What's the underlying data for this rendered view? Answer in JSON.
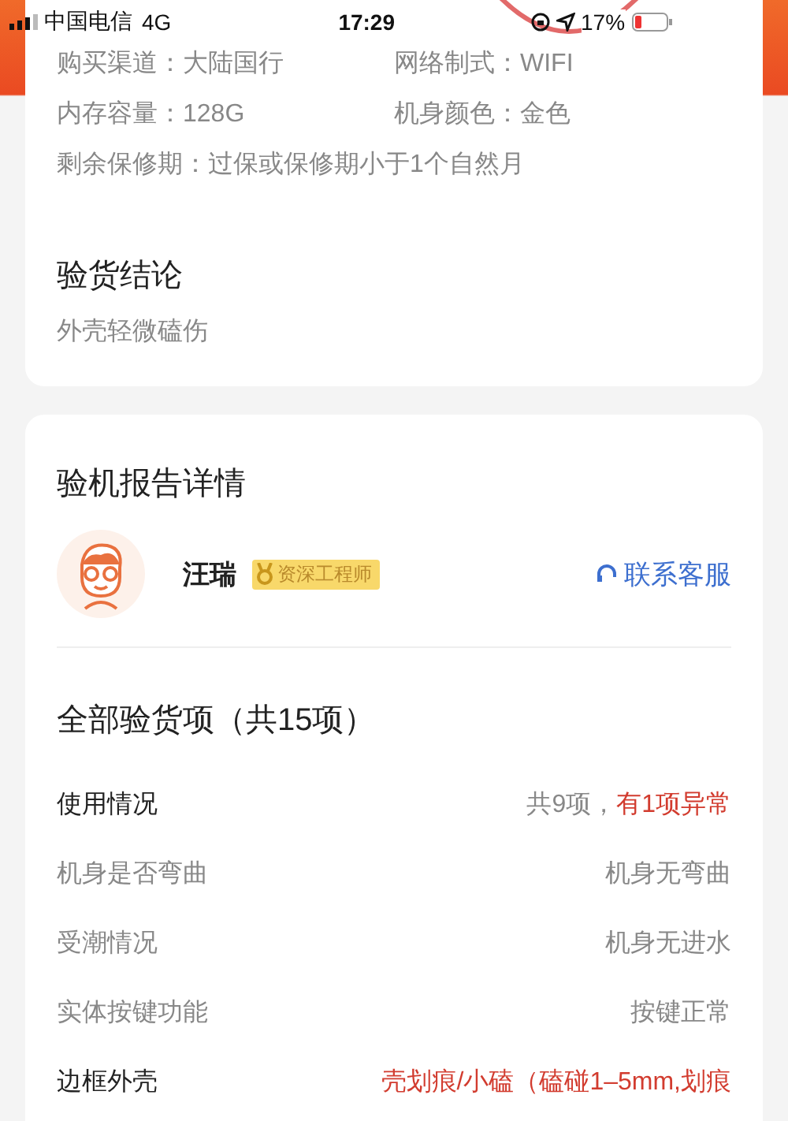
{
  "status_bar": {
    "carrier": "中国电信",
    "network": "4G",
    "time": "17:29",
    "battery": "17%"
  },
  "device_info": [
    {
      "text": "购买渠道：大陆国行"
    },
    {
      "text": "网络制式：WIFI"
    },
    {
      "text": "内存容量：128G"
    },
    {
      "text": "机身颜色：金色"
    },
    {
      "text": "剩余保修期：过保或保修期小于1个自然月"
    }
  ],
  "conclusion": {
    "title": "验货结论",
    "text": "外壳轻微磕伤"
  },
  "report": {
    "title": "验机报告详情",
    "engineer": {
      "name": "汪瑞",
      "badge": "资深工程师"
    },
    "contact": "联系客服",
    "section_title": "全部验货项（共15项）",
    "rows": [
      {
        "kind": "group",
        "label": "使用情况",
        "summary": "共9项，",
        "alert": "有1项异常"
      },
      {
        "kind": "item",
        "label": "机身是否弯曲",
        "value": "机身无弯曲",
        "abnormal": false
      },
      {
        "kind": "item",
        "label": "受潮情况",
        "value": "机身无进水",
        "abnormal": false
      },
      {
        "kind": "item",
        "label": "实体按键功能",
        "value": "按键正常",
        "abnormal": false
      },
      {
        "kind": "group",
        "label": "边框外壳",
        "value": "壳划痕/小磕（磕碰1–5mm,划痕",
        "abnormal": true
      }
    ]
  }
}
